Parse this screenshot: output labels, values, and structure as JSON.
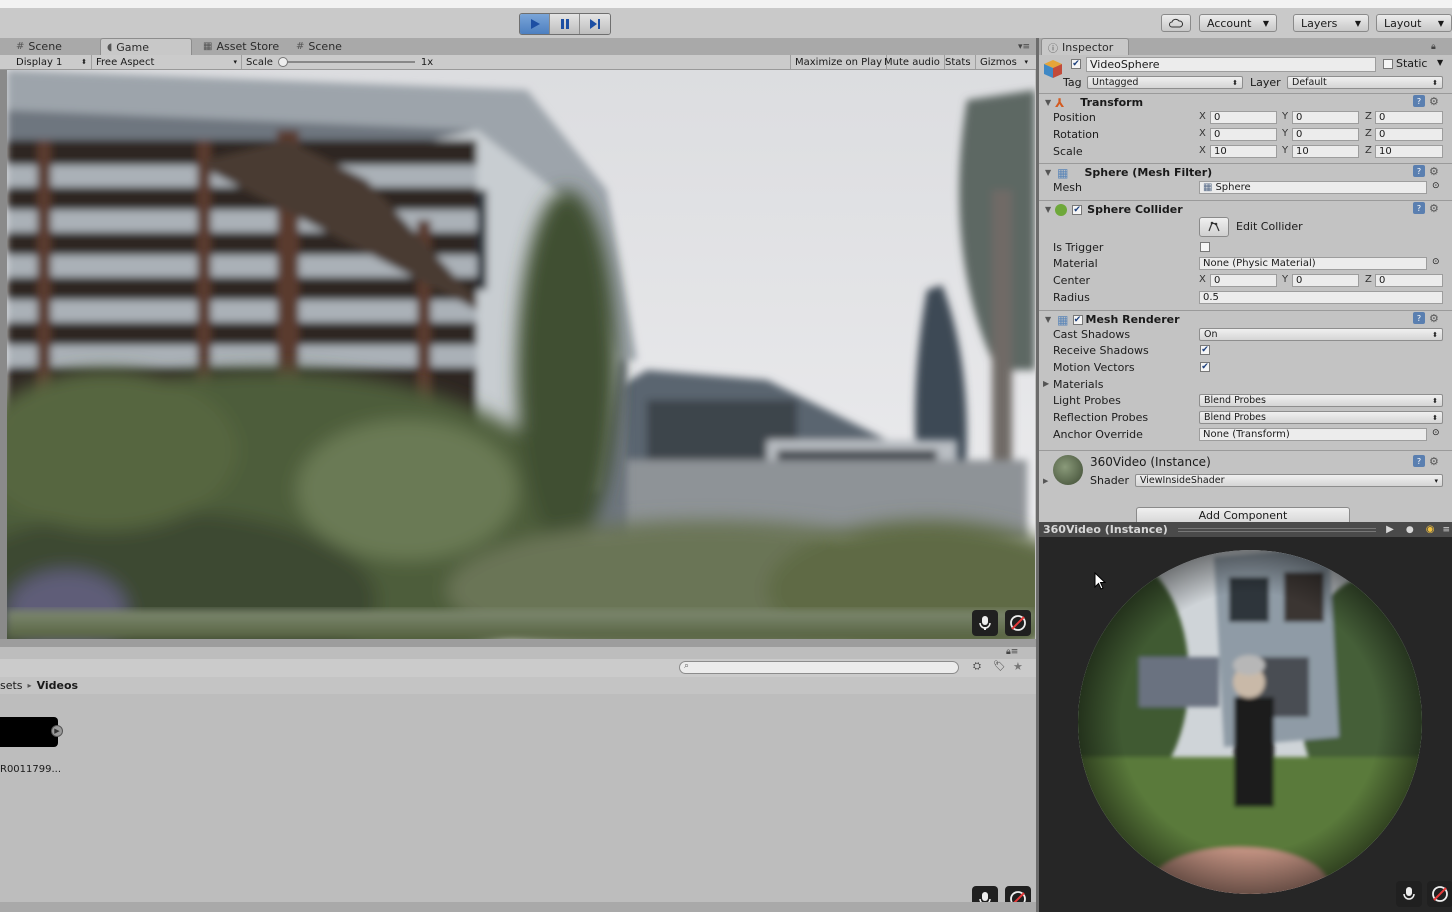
{
  "toolbar": {
    "play_icon": "play-icon",
    "pause_icon": "pause-icon",
    "step_icon": "step-icon",
    "cloud_icon": "cloud-icon",
    "account_label": "Account",
    "layers_label": "Layers",
    "layout_label": "Layout"
  },
  "tabs": [
    {
      "label": "Scene",
      "icon": "grid-icon"
    },
    {
      "label": "Game",
      "icon": "pacman-icon"
    },
    {
      "label": "Asset Store",
      "icon": "store-icon"
    },
    {
      "label": "Scene",
      "icon": "grid-icon"
    }
  ],
  "game_bar": {
    "display": "Display 1",
    "aspect": "Free Aspect",
    "scale_label": "Scale",
    "scale_value": "1x",
    "maximize": "Maximize on Play",
    "mute": "Mute audio",
    "stats": "Stats",
    "gizmos": "Gizmos"
  },
  "project": {
    "breadcrumb_root": "sets",
    "breadcrumb_sep": "▸",
    "breadcrumb_current": "Videos",
    "file_label": "R0011799..."
  },
  "inspector": {
    "tab_label": "Inspector",
    "object_name": "VideoSphere",
    "static_label": "Static",
    "tag_label": "Tag",
    "tag_value": "Untagged",
    "layer_label": "Layer",
    "layer_value": "Default",
    "transform": {
      "title": "Transform",
      "position_label": "Position",
      "rotation_label": "Rotation",
      "scale_label": "Scale",
      "position": [
        "0",
        "0",
        "0"
      ],
      "rotation": [
        "0",
        "0",
        "0"
      ],
      "scale": [
        "10",
        "10",
        "10"
      ],
      "axis_x": "X",
      "axis_y": "Y",
      "axis_z": "Z"
    },
    "mesh_filter": {
      "title": "Sphere (Mesh Filter)",
      "mesh_label": "Mesh",
      "mesh_value": "Sphere"
    },
    "sphere_collider": {
      "title": "Sphere Collider",
      "edit_label": "Edit Collider",
      "is_trigger_label": "Is Trigger",
      "material_label": "Material",
      "material_value": "None (Physic Material)",
      "center_label": "Center",
      "center": [
        "0",
        "0",
        "0"
      ],
      "radius_label": "Radius",
      "radius_value": "0.5"
    },
    "mesh_renderer": {
      "title": "Mesh Renderer",
      "cast_shadows_label": "Cast Shadows",
      "cast_shadows_value": "On",
      "receive_shadows_label": "Receive Shadows",
      "motion_vectors_label": "Motion Vectors",
      "materials_label": "Materials",
      "light_probes_label": "Light Probes",
      "light_probes_value": "Blend Probes",
      "reflection_probes_label": "Reflection Probes",
      "reflection_probes_value": "Blend Probes",
      "anchor_label": "Anchor Override",
      "anchor_value": "None (Transform)"
    },
    "material": {
      "title": "360Video (Instance)",
      "shader_label": "Shader",
      "shader_value": "ViewInsideShader"
    },
    "add_component": "Add Component"
  },
  "preview": {
    "title": "360Video (Instance)"
  }
}
